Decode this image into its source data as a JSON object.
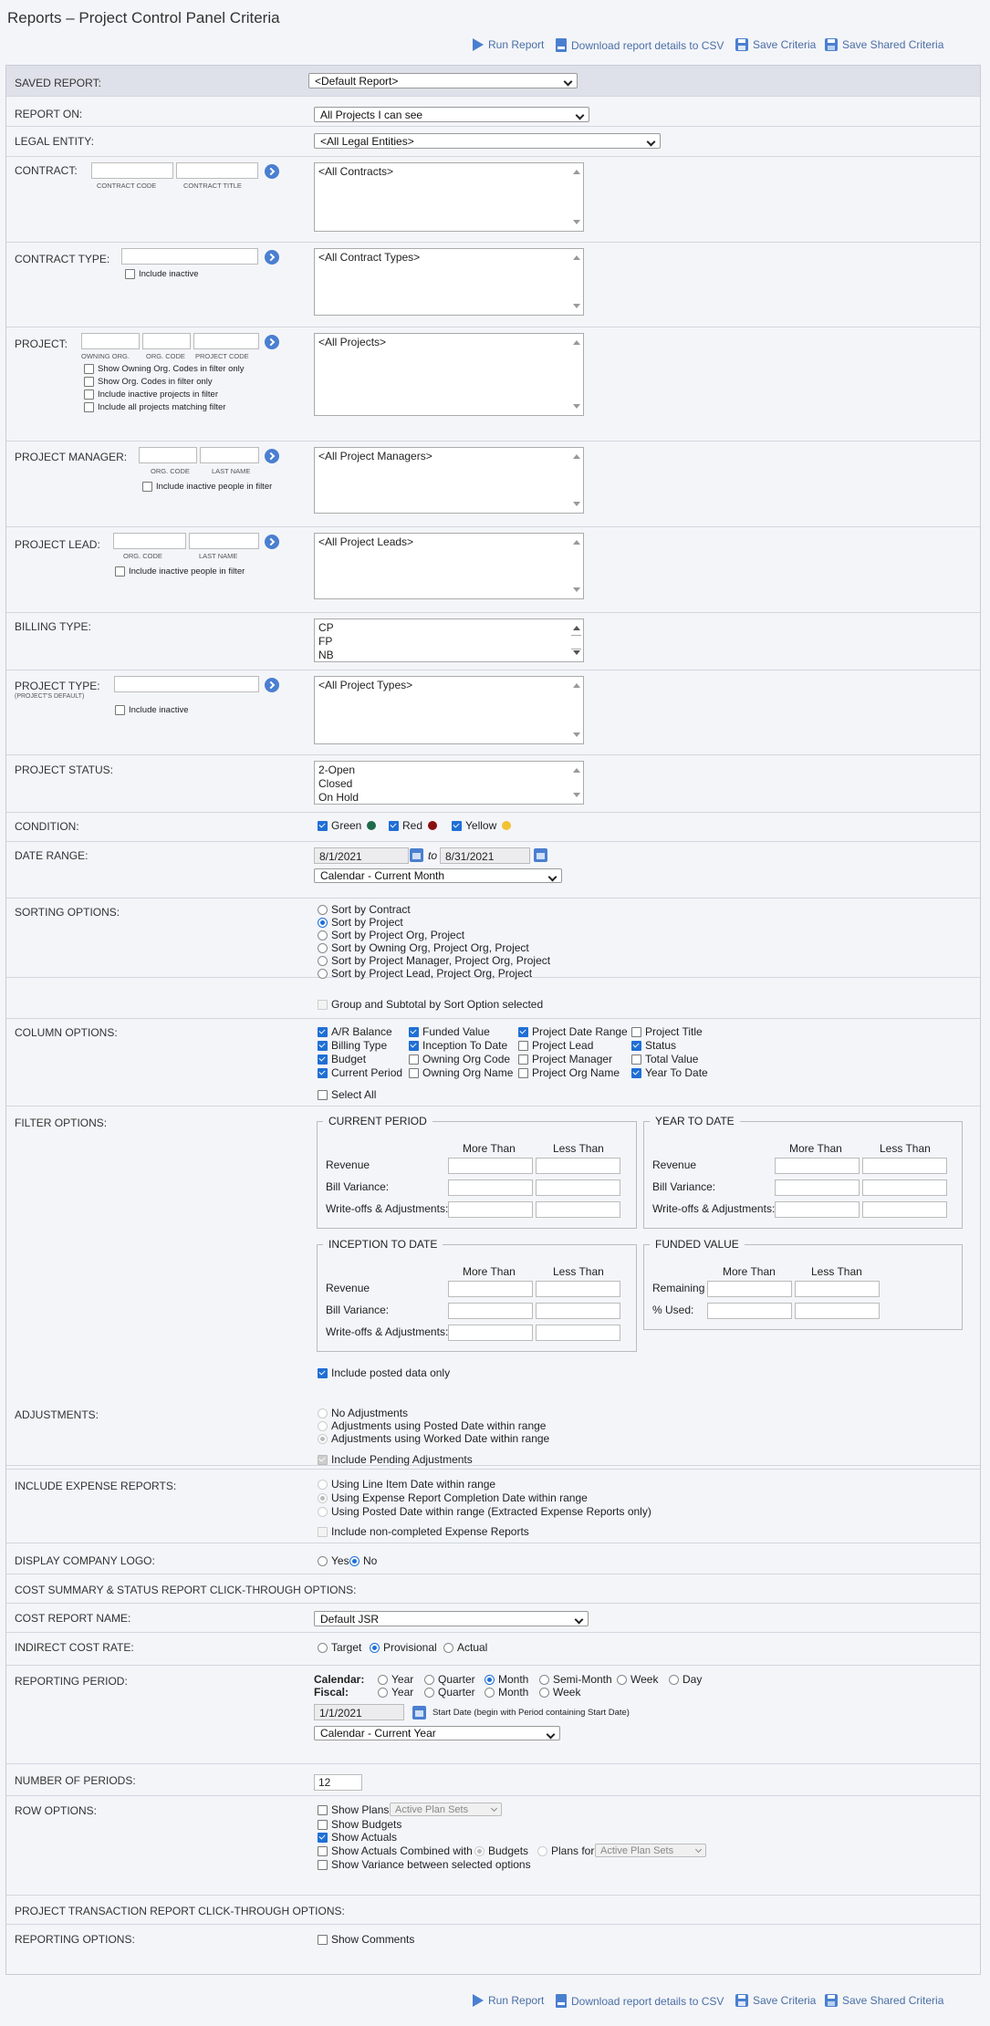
{
  "title": "Reports – Project Control Panel Criteria",
  "toolbar": {
    "run": "Run Report",
    "download": "Download report details to CSV",
    "save": "Save Criteria",
    "save_shared": "Save Shared Criteria"
  },
  "saved_report": {
    "label": "SAVED REPORT:",
    "value": "<Default Report>"
  },
  "report_on": {
    "label": "REPORT ON:",
    "value": "All Projects I can see"
  },
  "legal_entity": {
    "label": "LEGAL ENTITY:",
    "value": "<All Legal Entities>"
  },
  "contract": {
    "label": "CONTRACT:",
    "cap1": "CONTRACT CODE",
    "cap2": "CONTRACT TITLE",
    "list": "<All Contracts>"
  },
  "contract_type": {
    "label": "CONTRACT TYPE:",
    "inactive": "Include inactive",
    "list": "<All Contract Types>"
  },
  "project": {
    "label": "PROJECT:",
    "cap1": "OWNING ORG.",
    "cap2": "ORG. CODE",
    "cap3": "PROJECT CODE",
    "opt1": "Show Owning Org. Codes in filter only",
    "opt2": "Show Org. Codes in filter only",
    "opt3": "Include inactive projects in filter",
    "opt4": "Include all projects matching filter",
    "list": "<All Projects>"
  },
  "project_manager": {
    "label": "PROJECT MANAGER:",
    "cap1": "ORG. CODE",
    "cap2": "LAST NAME",
    "inactive": "Include inactive people in filter",
    "list": "<All Project Managers>"
  },
  "project_lead": {
    "label": "PROJECT LEAD:",
    "cap1": "ORG. CODE",
    "cap2": "LAST NAME",
    "inactive": "Include inactive people in filter",
    "list": "<All Project Leads>"
  },
  "billing_type": {
    "label": "BILLING TYPE:",
    "items": [
      "CP",
      "FP",
      "NB"
    ]
  },
  "project_type": {
    "label": "PROJECT TYPE:",
    "sub": "(PROJECT'S DEFAULT)",
    "inactive": "Include inactive",
    "list": "<All Project Types>"
  },
  "project_status": {
    "label": "PROJECT STATUS:",
    "items": [
      "2-Open",
      "Closed",
      "On Hold"
    ]
  },
  "condition": {
    "label": "CONDITION:",
    "green": "Green",
    "red": "Red",
    "yellow": "Yellow",
    "green_color": "#1e6b4a",
    "red_color": "#8b0f0f",
    "yellow_color": "#f2c230"
  },
  "date_range": {
    "label": "DATE RANGE:",
    "from": "8/1/2021",
    "to_word": "to",
    "to": "8/31/2021",
    "preset": "Calendar - Current Month"
  },
  "sorting": {
    "label": "SORTING OPTIONS:",
    "opts": [
      "Sort by Contract",
      "Sort by Project",
      "Sort by Project Org, Project",
      "Sort by Owning Org, Project Org, Project",
      "Sort by Project Manager, Project Org, Project",
      "Sort by Project Lead, Project Org, Project"
    ],
    "selected": "Sort by Project",
    "group": "Group and Subtotal by Sort Option selected"
  },
  "columns": {
    "label": "COLUMN OPTIONS:",
    "c1": [
      "A/R Balance",
      "Billing Type",
      "Budget",
      "Current Period"
    ],
    "c2": [
      "Funded Value",
      "Inception To Date",
      "Owning Org Code",
      "Owning Org Name"
    ],
    "c3": [
      "Project Date Range",
      "Project Lead",
      "Project Manager",
      "Project Org Name"
    ],
    "c4": [
      "Project Title",
      "Status",
      "Total Value",
      "Year To Date"
    ],
    "select_all": "Select All"
  },
  "filter": {
    "label": "FILTER OPTIONS:",
    "more": "More Than",
    "less": "Less Than",
    "current_period": "CURRENT PERIOD",
    "year_to_date": "YEAR TO DATE",
    "inception": "INCEPTION TO DATE",
    "funded": "FUNDED VALUE",
    "revenue": "Revenue",
    "bill_var": "Bill Variance:",
    "writeoffs": "Write-offs & Adjustments:",
    "remaining": "Remaining",
    "pct_used": "% Used:",
    "posted_only": "Include posted data only"
  },
  "adjustments": {
    "label": "ADJUSTMENTS:",
    "opts": [
      "No Adjustments",
      "Adjustments using Posted Date within range",
      "Adjustments using Worked Date within range"
    ],
    "pending": "Include Pending Adjustments"
  },
  "expense": {
    "label": "INCLUDE EXPENSE REPORTS:",
    "opts": [
      "Using Line Item Date within range",
      "Using Expense Report Completion Date within range",
      "Using Posted Date within range (Extracted Expense Reports only)"
    ],
    "noncompleted": "Include non-completed Expense Reports"
  },
  "logo": {
    "label": "DISPLAY COMPANY LOGO:",
    "yes": "Yes",
    "no": "No"
  },
  "cost_summary_header": "COST SUMMARY & STATUS REPORT CLICK-THROUGH OPTIONS:",
  "cost_report": {
    "label": "COST REPORT NAME:",
    "value": "Default JSR"
  },
  "indirect": {
    "label": "INDIRECT COST RATE:",
    "target": "Target",
    "provisional": "Provisional",
    "actual": "Actual"
  },
  "reporting_period": {
    "label": "REPORTING PERIOD:",
    "calendar": "Calendar:",
    "fiscal": "Fiscal:",
    "year": "Year",
    "quarter": "Quarter",
    "month": "Month",
    "semi": "Semi-Month",
    "week": "Week",
    "day": "Day",
    "start": "1/1/2021",
    "start_note": "Start Date (begin with Period containing Start Date)",
    "preset": "Calendar - Current Year"
  },
  "num_periods": {
    "label": "NUMBER OF PERIODS:",
    "value": "12"
  },
  "row_options": {
    "label": "ROW OPTIONS:",
    "plans": "Show Plans",
    "plans_sel": "Active Plan Sets",
    "budgets": "Show Budgets",
    "actuals": "Show Actuals",
    "combined": "Show Actuals Combined with",
    "c_budgets": "Budgets",
    "c_plans": "Plans for",
    "c_plans_sel": "Active Plan Sets",
    "variance": "Show Variance between selected options"
  },
  "transaction_header": "PROJECT TRANSACTION REPORT CLICK-THROUGH OPTIONS:",
  "reporting_options": {
    "label": "REPORTING OPTIONS:",
    "comments": "Show Comments"
  }
}
